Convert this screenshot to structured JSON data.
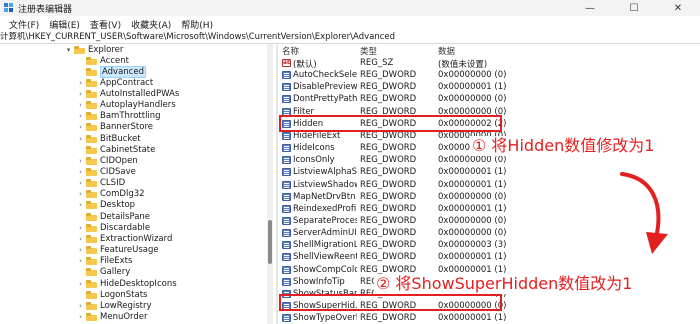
{
  "window": {
    "title": "注册表编辑器",
    "minimize_glyph": "—",
    "maximize_glyph": "☐",
    "close_glyph": "✕"
  },
  "menu": [
    "文件(F)",
    "编辑(E)",
    "查看(V)",
    "收藏夹(A)",
    "帮助(H)"
  ],
  "address": "计算机\\HKEY_CURRENT_USER\\Software\\Microsoft\\Windows\\CurrentVersion\\Explorer\\Advanced",
  "tree": {
    "parent": "Explorer",
    "items": [
      {
        "label": "Accent",
        "expandable": false,
        "selected": false
      },
      {
        "label": "Advanced",
        "expandable": false,
        "selected": true
      },
      {
        "label": "AppContract",
        "expandable": true,
        "selected": false
      },
      {
        "label": "AutoInstalledPWAs",
        "expandable": true,
        "selected": false
      },
      {
        "label": "AutoplayHandlers",
        "expandable": true,
        "selected": false
      },
      {
        "label": "BamThrottling",
        "expandable": true,
        "selected": false
      },
      {
        "label": "BannerStore",
        "expandable": true,
        "selected": false
      },
      {
        "label": "BitBucket",
        "expandable": true,
        "selected": false
      },
      {
        "label": "CabinetState",
        "expandable": false,
        "selected": false
      },
      {
        "label": "CIDOpen",
        "expandable": true,
        "selected": false
      },
      {
        "label": "CIDSave",
        "expandable": true,
        "selected": false
      },
      {
        "label": "CLSID",
        "expandable": true,
        "selected": false
      },
      {
        "label": "ComDlg32",
        "expandable": true,
        "selected": false
      },
      {
        "label": "Desktop",
        "expandable": true,
        "selected": false
      },
      {
        "label": "DetailsPane",
        "expandable": false,
        "selected": false
      },
      {
        "label": "Discardable",
        "expandable": true,
        "selected": false
      },
      {
        "label": "ExtractionWizard",
        "expandable": true,
        "selected": false
      },
      {
        "label": "FeatureUsage",
        "expandable": true,
        "selected": false
      },
      {
        "label": "FileExts",
        "expandable": true,
        "selected": false
      },
      {
        "label": "Gallery",
        "expandable": false,
        "selected": false
      },
      {
        "label": "HideDesktopIcons",
        "expandable": true,
        "selected": false
      },
      {
        "label": "LogonStats",
        "expandable": false,
        "selected": false
      },
      {
        "label": "LowRegistry",
        "expandable": true,
        "selected": false
      },
      {
        "label": "MenuOrder",
        "expandable": true,
        "selected": false
      }
    ]
  },
  "values": {
    "columns": {
      "name": "名称",
      "type": "类型",
      "data": "数据"
    },
    "rows": [
      {
        "name": "(默认)",
        "type": "REG_SZ",
        "data": "(数值未设置)",
        "kind": "str"
      },
      {
        "name": "AutoCheckSelect",
        "type": "REG_DWORD",
        "data": "0x00000000 (0)",
        "kind": "bin"
      },
      {
        "name": "DisablePreview...",
        "type": "REG_DWORD",
        "data": "0x00000001 (1)",
        "kind": "bin"
      },
      {
        "name": "DontPrettyPath",
        "type": "REG_DWORD",
        "data": "0x00000000 (0)",
        "kind": "bin"
      },
      {
        "name": "Filter",
        "type": "REG_DWORD",
        "data": "0x00000000 (0)",
        "kind": "bin"
      },
      {
        "name": "Hidden",
        "type": "REG_DWORD",
        "data": "0x00000002 (2)",
        "kind": "bin"
      },
      {
        "name": "HideFileExt",
        "type": "REG_DWORD",
        "data": "0x00000000 (0)",
        "kind": "bin"
      },
      {
        "name": "HideIcons",
        "type": "REG_DWORD",
        "data": "0x00000000 (0)",
        "kind": "bin"
      },
      {
        "name": "IconsOnly",
        "type": "REG_DWORD",
        "data": "0x00000000 (0)",
        "kind": "bin"
      },
      {
        "name": "ListviewAlphaS...",
        "type": "REG_DWORD",
        "data": "0x00000001 (1)",
        "kind": "bin"
      },
      {
        "name": "ListviewShadow",
        "type": "REG_DWORD",
        "data": "0x00000001 (1)",
        "kind": "bin"
      },
      {
        "name": "MapNetDrvBtn",
        "type": "REG_DWORD",
        "data": "0x00000000 (0)",
        "kind": "bin"
      },
      {
        "name": "ReindexedProfile",
        "type": "REG_DWORD",
        "data": "0x00000001 (1)",
        "kind": "bin"
      },
      {
        "name": "SeparateProcess",
        "type": "REG_DWORD",
        "data": "0x00000000 (0)",
        "kind": "bin"
      },
      {
        "name": "ServerAdminUI",
        "type": "REG_DWORD",
        "data": "0x00000000 (0)",
        "kind": "bin"
      },
      {
        "name": "ShellMigrationL...",
        "type": "REG_DWORD",
        "data": "0x00000003 (3)",
        "kind": "bin"
      },
      {
        "name": "ShellViewReent...",
        "type": "REG_DWORD",
        "data": "0x00000001 (1)",
        "kind": "bin"
      },
      {
        "name": "ShowCompColor",
        "type": "REG_DWORD",
        "data": "0x00000001 (1)",
        "kind": "bin"
      },
      {
        "name": "ShowInfoTip",
        "type": "REG_DWORD",
        "data": "0x00000001 (1)",
        "kind": "bin"
      },
      {
        "name": "ShowStatusBar",
        "type": "REG_DWORD",
        "data": "0x00000001 (1)",
        "kind": "bin"
      },
      {
        "name": "ShowSuperHid...",
        "type": "REG_DWORD",
        "data": "0x00000000 (0)",
        "kind": "bin"
      },
      {
        "name": "ShowTypeOverl...",
        "type": "REG_DWORD",
        "data": "0x00000001 (1)",
        "kind": "bin"
      }
    ]
  },
  "annotations": {
    "step1": "① 将Hidden数值修改为1",
    "step2": "② 将ShowSuperHidden数值改为1",
    "color": "#e32020"
  }
}
